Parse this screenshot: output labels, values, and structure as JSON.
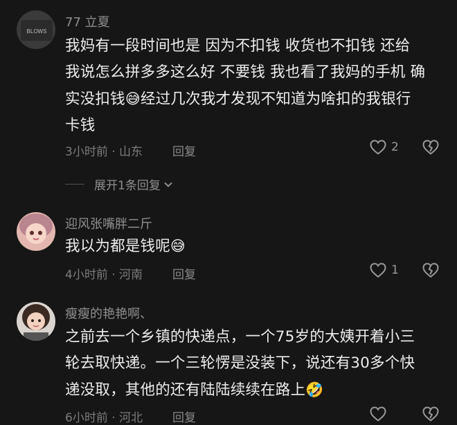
{
  "comments": [
    {
      "username": "77 立夏",
      "lines": [
        "我妈有一段时间也是 因为不扣钱  收货也不扣钱  还给",
        "我说怎么拼多多这么好 不要钱  我也看了我妈的手机 确",
        "实没扣钱",
        "经过几次我才发现不知道为啥扣的我银行",
        "卡钱"
      ],
      "emoji": "😅",
      "time_location": "3小时前 · 山东",
      "reply_label": "回复",
      "like_count": "2",
      "expand_label": "展开1条回复",
      "avatar_text": "BLOWS"
    },
    {
      "username": "迎风张嘴胖二斤",
      "lines": [
        "我以为都是钱呢"
      ],
      "emoji": "😅",
      "time_location": "4小时前 · 河南",
      "reply_label": "回复",
      "like_count": "1"
    },
    {
      "username": "瘦瘦的艳艳啊、",
      "lines": [
        "之前去一个乡镇的快递点，一个75岁的大姨开着小三",
        "轮去取快递。一个三轮愣是没装下，说还有30多个快",
        "递没取，其他的还有陆陆续续在路上"
      ],
      "emoji": "🤣",
      "time_location": "6小时前 · 河北",
      "reply_label": "回复"
    }
  ],
  "colors": {
    "background": "#161616",
    "text": "#ededed",
    "muted": "#8f8f8f"
  }
}
